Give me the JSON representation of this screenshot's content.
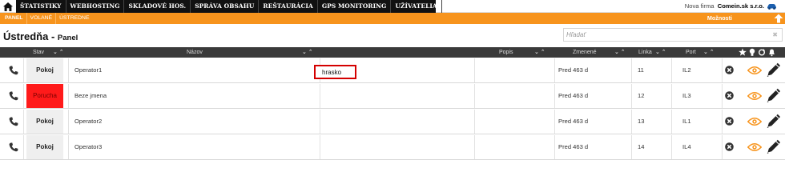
{
  "topbar": {
    "menu": [
      "ŠTATISTIKY",
      "WEBHOSTING",
      "SKLADOVÉ HOS.",
      "SPRÁVA OBSAHU",
      "REŠTAURÁCIA",
      "GPS MONITORING",
      "UŽÍVATELIA",
      "»"
    ],
    "firm_label": "Nova firma",
    "firm_name": "Comein.sk s.r.o."
  },
  "subnav": {
    "items": [
      "PANEL",
      "VOLANÉ",
      "ÚSTREDNE"
    ],
    "options_label": "Možnosti"
  },
  "page": {
    "title": "Ústredňa - ",
    "subtitle": "Panel"
  },
  "search": {
    "placeholder": "Hľadať",
    "value": ""
  },
  "table": {
    "headers": {
      "stav": "Stav",
      "nazov": "Názov",
      "popis": "Popis",
      "zmenene": "Zmenené",
      "linka": "Linka",
      "port": "Port"
    },
    "sort_arrows": "⌄ ⌃",
    "rows": [
      {
        "stav": "Pokoj",
        "stav_color": "#efefef",
        "nazov": "Operator1",
        "zmenene": "Pred 463 d",
        "linka": "11",
        "port": "IL2"
      },
      {
        "stav": "Porucha",
        "stav_color": "#ff1a1a",
        "nazov": "Beze jmena",
        "zmenene": "Pred 463 d",
        "linka": "12",
        "port": "IL3"
      },
      {
        "stav": "Pokoj",
        "stav_color": "#efefef",
        "nazov": "Operator2",
        "zmenene": "Pred 463 d",
        "linka": "13",
        "port": "IL1"
      },
      {
        "stav": "Pokoj",
        "stav_color": "#efefef",
        "nazov": "Operator3",
        "zmenene": "Pred 463 d",
        "linka": "14",
        "port": "IL4"
      }
    ],
    "edit_value": "hrasko"
  },
  "colors": {
    "accent": "#f7941d",
    "menu_bg": "#111111",
    "header_bg": "#3a3a3a",
    "alarm": "#ff1a1a"
  },
  "icons": [
    "home-icon",
    "car-icon",
    "arrow-up-icon",
    "phone-icon",
    "close-circle-icon",
    "eye-icon",
    "pencil-icon",
    "star-icon",
    "bulb-icon",
    "refresh-icon",
    "bell-icon"
  ]
}
